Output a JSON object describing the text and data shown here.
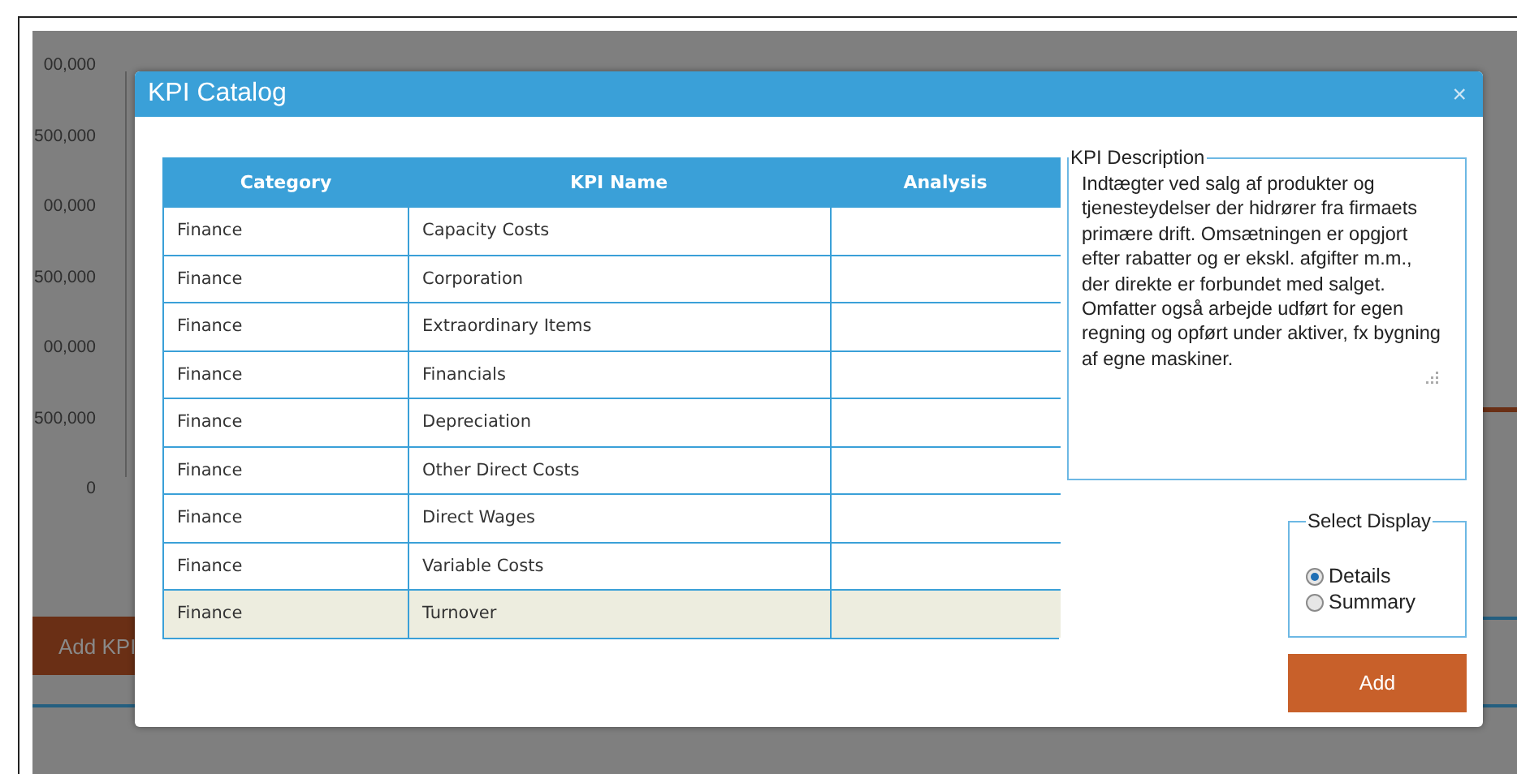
{
  "background": {
    "axis_labels": [
      "00,000",
      "500,000",
      "00,000",
      "500,000",
      "00,000",
      "500,000",
      "0"
    ],
    "add_button": "Add KPI"
  },
  "dialog": {
    "title": "KPI Catalog",
    "close": "×",
    "table": {
      "columns": [
        "Category",
        "KPI Name",
        "Analysis"
      ],
      "rows": [
        {
          "category": "Finance",
          "kpi_name": "Capacity Costs",
          "selected": false
        },
        {
          "category": "Finance",
          "kpi_name": "Corporation",
          "selected": false
        },
        {
          "category": "Finance",
          "kpi_name": "Extraordinary Items",
          "selected": false
        },
        {
          "category": "Finance",
          "kpi_name": "Financials",
          "selected": false
        },
        {
          "category": "Finance",
          "kpi_name": "Depreciation",
          "selected": false
        },
        {
          "category": "Finance",
          "kpi_name": "Other Direct Costs",
          "selected": false
        },
        {
          "category": "Finance",
          "kpi_name": "Direct Wages",
          "selected": false
        },
        {
          "category": "Finance",
          "kpi_name": "Variable Costs",
          "selected": false
        },
        {
          "category": "Finance",
          "kpi_name": "Turnover",
          "selected": true
        }
      ]
    },
    "description": {
      "legend": "KPI Description",
      "text": "Indtægter ved salg af produkter og tjenesteydelser der hidrører fra firmaets primære drift. Omsætningen er opgjort efter rabatter og er ekskl. afgifter m.m., der direkte er forbundet med salget. Omfatter også arbejde udført for egen regning og opført under aktiver, fx bygning af egne maskiner."
    },
    "display": {
      "legend": "Select Display",
      "options": [
        {
          "label": "Details",
          "selected": true
        },
        {
          "label": "Summary",
          "selected": false
        }
      ]
    },
    "add_button": "Add"
  }
}
